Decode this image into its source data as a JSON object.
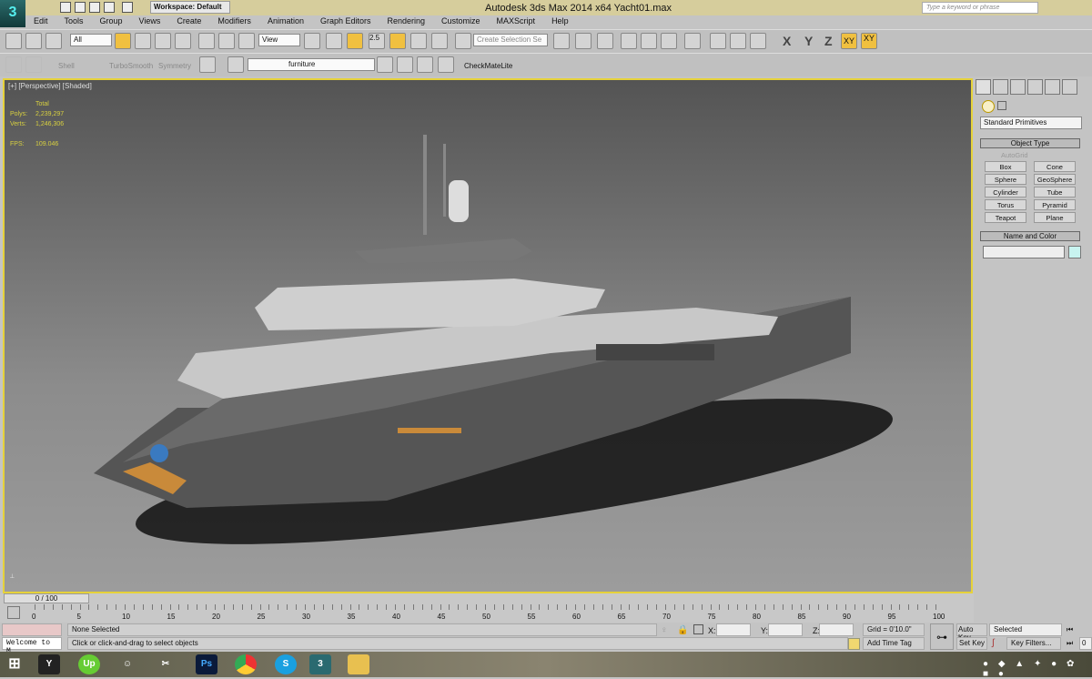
{
  "app": {
    "title": "Autodesk 3ds Max  2014 x64      Yacht01.max",
    "workspace": "Workspace: Default",
    "search_placeholder": "Type a keyword or phrase"
  },
  "menu": [
    "Edit",
    "Tools",
    "Group",
    "Views",
    "Create",
    "Modifiers",
    "Animation",
    "Graph Editors",
    "Rendering",
    "Customize",
    "MAXScript",
    "Help"
  ],
  "toolbar": {
    "filter": "All",
    "ref_coord": "View",
    "snap_angle": "2.5",
    "named_selection": "Create Selection Se",
    "axes": [
      "X",
      "Y",
      "Z",
      "XY",
      "XY"
    ]
  },
  "toolbar2": {
    "shell": "Shell",
    "turbosmooth": "TurboSmooth",
    "symmetry": "Symmetry",
    "layer": "furniture",
    "checkmate": "CheckMateLite"
  },
  "viewport": {
    "label": "[+] [Perspective] [Shaded]",
    "stats": {
      "total": "Total",
      "polys_label": "Polys:",
      "polys": "2,239,297",
      "verts_label": "Verts:",
      "verts": "1,246,306",
      "fps_label": "FPS:",
      "fps": "109.046"
    }
  },
  "command_panel": {
    "category": "Standard Primitives",
    "rollout1": "Object Type",
    "autogrid": "AutoGrid",
    "buttons": [
      "Box",
      "Cone",
      "Sphere",
      "GeoSphere",
      "Cylinder",
      "Tube",
      "Torus",
      "Pyramid",
      "Teapot",
      "Plane"
    ],
    "rollout2": "Name and Color",
    "swatch_color": "#c8f4f0"
  },
  "timeline": {
    "frame": "0 / 100",
    "ticks": [
      "0",
      "5",
      "10",
      "15",
      "20",
      "25",
      "30",
      "35",
      "40",
      "45",
      "50",
      "55",
      "60",
      "65",
      "70",
      "75",
      "80",
      "85",
      "90",
      "95",
      "100"
    ]
  },
  "status": {
    "maxscript": "Welcome to M",
    "selection": "None Selected",
    "prompt": "Click or click-and-drag to select objects",
    "x_label": "X:",
    "y_label": "Y:",
    "z_label": "Z:",
    "grid": "Grid = 0'10.0\"",
    "add_time_tag": "Add Time Tag",
    "auto_key": "Auto Key",
    "set_key": "Set Key",
    "key_mode": "Selected",
    "key_filters": "Key Filters...",
    "current_frame": "0"
  },
  "taskbar": [
    "start",
    "Ps",
    "chrome",
    "skype",
    "3ds Max",
    "explorer"
  ]
}
